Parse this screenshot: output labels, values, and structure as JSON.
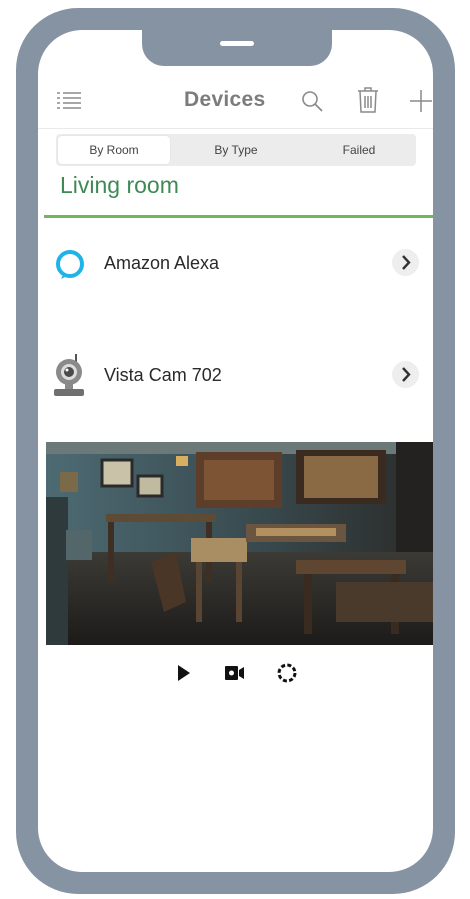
{
  "nav": {
    "title": "Devices",
    "icons": [
      "menu-icon",
      "search-icon",
      "trash-icon",
      "plus-icon"
    ]
  },
  "tabs": [
    {
      "label": "By Room",
      "active": true
    },
    {
      "label": "By Type",
      "active": false
    },
    {
      "label": "Failed",
      "active": false
    }
  ],
  "room": {
    "name": "Living room",
    "accent": "#6fb85a",
    "title_color": "#3d8a54"
  },
  "devices": [
    {
      "name": "Amazon Alexa",
      "icon": "alexa-icon"
    },
    {
      "name": "Vista Cam 702",
      "icon": "webcam-icon"
    }
  ],
  "camera_controls": [
    "play-icon",
    "record-icon",
    "snapshot-icon"
  ],
  "colors": {
    "frame": "#8593a3",
    "alexa": "#1fb4e8"
  }
}
